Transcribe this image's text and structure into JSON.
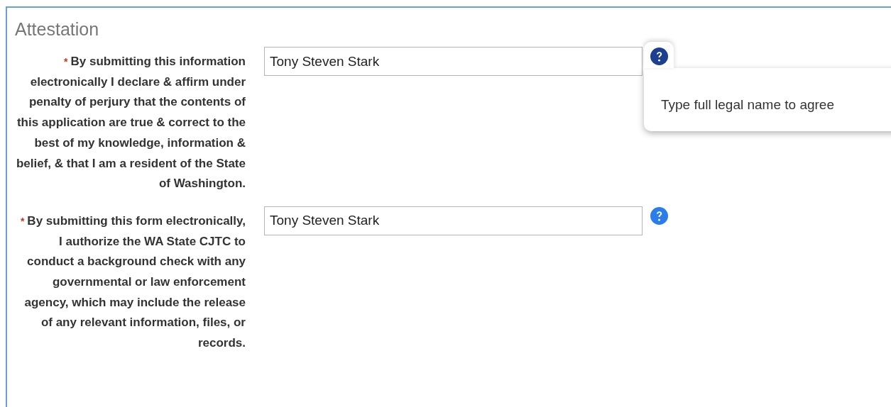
{
  "section": {
    "title": "Attestation"
  },
  "fields": [
    {
      "required_mark": "*",
      "label": "By submitting this information electronically I declare & affirm under penalty of perjury that the contents of this application are true & correct to the best of my knowledge, information & belief, & that I am a resident of the State of Washington.",
      "value": "Tony Steven Stark",
      "help_open": true,
      "help_text": "Type full legal name to agree"
    },
    {
      "required_mark": "*",
      "label": "By submitting this form electronically, I authorize the WA State CJTC to conduct a background check with any governmental or law enforcement agency, which may include the release of any relevant information, files, or records.",
      "value": "Tony Steven Stark",
      "help_open": false
    }
  ]
}
